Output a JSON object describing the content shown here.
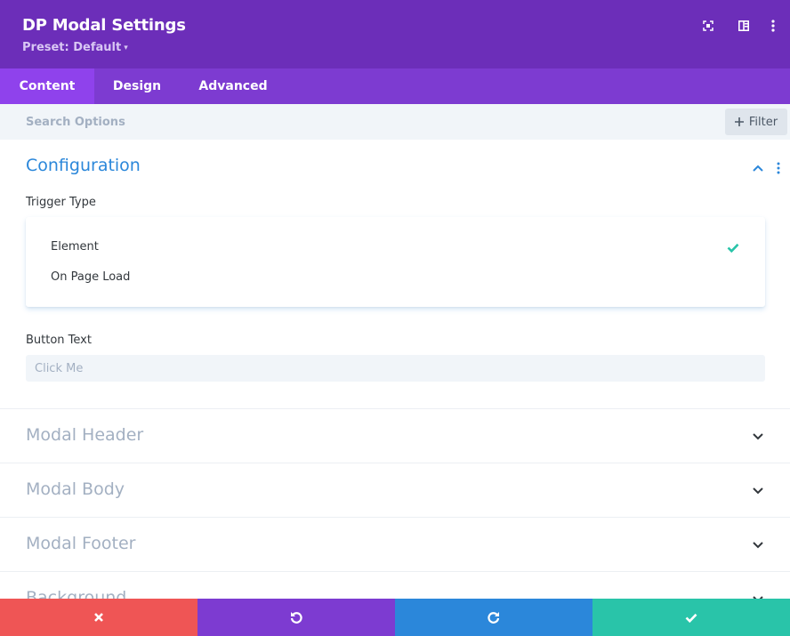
{
  "header": {
    "title": "DP Modal Settings",
    "preset_label": "Preset: Default",
    "preset_caret": "▾",
    "icons": [
      "expand-icon",
      "split-view-icon",
      "more-vertical-icon"
    ]
  },
  "tabs": [
    {
      "label": "Content",
      "active": true
    },
    {
      "label": "Design",
      "active": false
    },
    {
      "label": "Advanced",
      "active": false
    }
  ],
  "search": {
    "placeholder": "Search Options",
    "value": "",
    "filter_label": "Filter"
  },
  "configuration": {
    "title": "Configuration",
    "trigger_type": {
      "label": "Trigger Type",
      "options": [
        "Element",
        "On Page Load"
      ],
      "selected": "Element"
    },
    "button_text": {
      "label": "Button Text",
      "placeholder": "Click Me",
      "value": ""
    }
  },
  "sections": [
    {
      "title": "Modal Header"
    },
    {
      "title": "Modal Body"
    },
    {
      "title": "Modal Footer"
    },
    {
      "title": "Background"
    }
  ],
  "footer": {
    "buttons": [
      "cancel",
      "undo",
      "redo",
      "save"
    ]
  },
  "colors": {
    "header": "#6c2eb9",
    "tabs": "#7d3bd1",
    "active_tab": "#8f42ec",
    "accent_blue": "#2b87da",
    "check_green": "#29c4a9",
    "cancel": "#ef5555",
    "undo": "#7d3bd1",
    "redo": "#2b87da",
    "save": "#29c4a9"
  }
}
